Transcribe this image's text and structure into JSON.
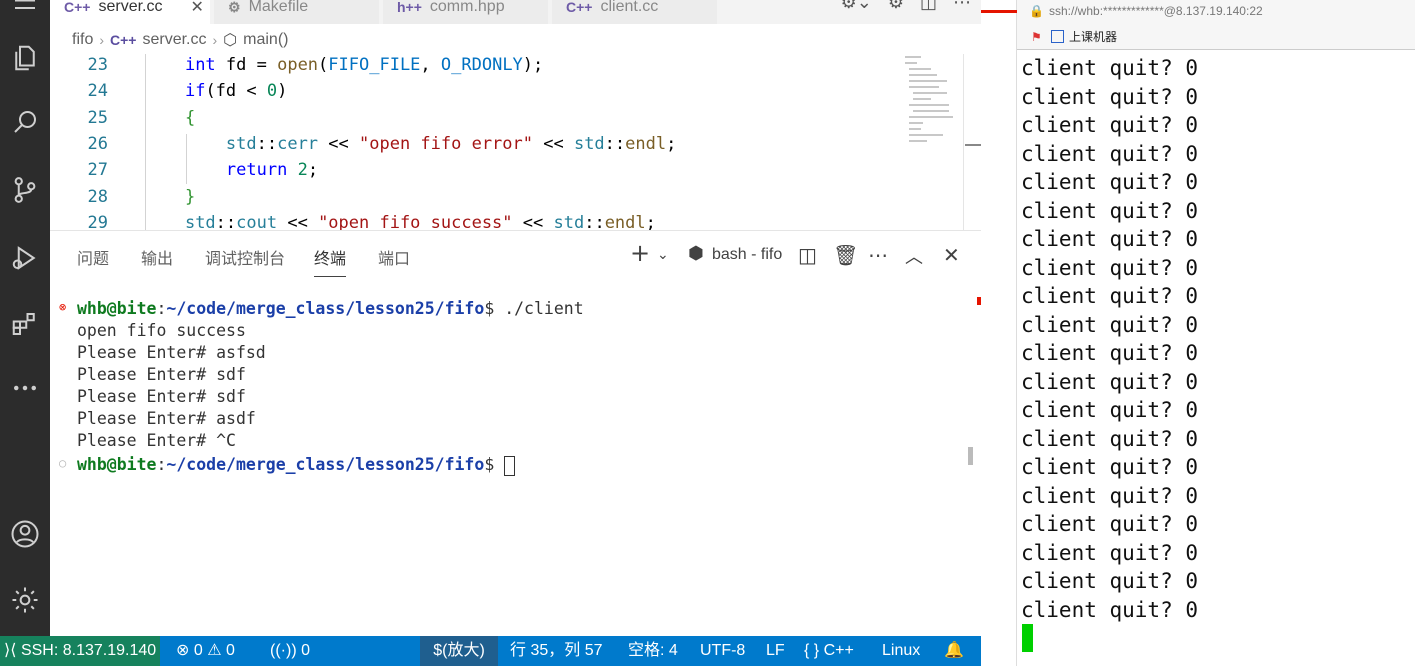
{
  "tabs": [
    {
      "label": "server.cc",
      "icon": "C++",
      "active": true
    },
    {
      "label": "Makefile",
      "icon": "gear"
    },
    {
      "label": "comm.hpp",
      "icon": "h++"
    },
    {
      "label": "client.cc",
      "icon": "C++"
    }
  ],
  "breadcrumb": {
    "folder": "fifo",
    "file": "server.cc",
    "symbol": "main()",
    "file_icon": "C++"
  },
  "code_lines": [
    {
      "n": "23",
      "indent": "    ",
      "parts": [
        [
          "kw",
          "int"
        ],
        [
          "",
          " fd = "
        ],
        [
          "fn",
          "open"
        ],
        [
          "",
          "("
        ],
        [
          "cst",
          "FIFO_FILE"
        ],
        [
          "",
          ", "
        ],
        [
          "cst",
          "O_RDONLY"
        ],
        [
          "",
          ");"
        ]
      ]
    },
    {
      "n": "24",
      "indent": "    ",
      "parts": [
        [
          "kw",
          "if"
        ],
        [
          "",
          "(fd < "
        ],
        [
          "num",
          "0"
        ],
        [
          "",
          ")"
        ]
      ]
    },
    {
      "n": "25",
      "indent": "    ",
      "parts": [
        [
          "br",
          "{"
        ]
      ]
    },
    {
      "n": "26",
      "indent": "        ",
      "parts": [
        [
          "ty",
          "std"
        ],
        [
          "",
          "::"
        ],
        [
          "ty",
          "cerr"
        ],
        [
          "",
          " << "
        ],
        [
          "str",
          "\"open fifo error\""
        ],
        [
          "",
          " << "
        ],
        [
          "ty",
          "std"
        ],
        [
          "",
          "::"
        ],
        [
          "fn",
          "endl"
        ],
        [
          "",
          ";"
        ]
      ]
    },
    {
      "n": "27",
      "indent": "        ",
      "parts": [
        [
          "kw",
          "return"
        ],
        [
          "",
          " "
        ],
        [
          "num",
          "2"
        ],
        [
          "",
          ";"
        ]
      ]
    },
    {
      "n": "28",
      "indent": "    ",
      "parts": [
        [
          "br",
          "}"
        ]
      ]
    },
    {
      "n": "29",
      "indent": "    ",
      "parts": [
        [
          "ty",
          "std"
        ],
        [
          "",
          "::"
        ],
        [
          "ty",
          "cout"
        ],
        [
          "",
          " << "
        ],
        [
          "str",
          "\"open fifo success\""
        ],
        [
          "",
          " << "
        ],
        [
          "ty",
          "std"
        ],
        [
          "",
          "::"
        ],
        [
          "fn",
          "endl"
        ],
        [
          "",
          ";"
        ]
      ]
    }
  ],
  "panel": {
    "tabs": [
      "问题",
      "输出",
      "调试控制台",
      "终端",
      "端口"
    ],
    "active_tab": "终端",
    "terminal_name": "bash - fifo"
  },
  "terminal": {
    "prompt_user": "whb@bite",
    "prompt_path": "~/code/merge_class/lesson25/fifo",
    "prompt_suffix": "$ ",
    "command": "./client",
    "output": [
      "open fifo success",
      "Please Enter# asfsd",
      "Please Enter# sdf",
      "Please Enter# sdf",
      "Please Enter# asdf",
      "Please Enter# ^C"
    ]
  },
  "statusbar": {
    "remote": "SSH: 8.137.19.140",
    "errors": "0",
    "warnings": "0",
    "ports": "0",
    "mode": "$(放大)",
    "position": "行 35，列 57",
    "spaces": "空格: 4",
    "encoding": "UTF-8",
    "eol": "LF",
    "language": "C++",
    "platform": "Linux"
  },
  "ssh": {
    "title": "ssh://whb:*************@8.137.19.140:22",
    "toolbar_label": "上课机器",
    "lines": [
      "client quit? 0",
      "client quit? 0",
      "client quit? 0",
      "client quit? 0",
      "client quit? 0",
      "client quit? 0",
      "client quit? 0",
      "client quit? 0",
      "client quit? 0",
      "client quit? 0",
      "client quit? 0",
      "client quit? 0",
      "client quit? 0",
      "client quit? 0",
      "client quit? 0",
      "client quit? 0",
      "client quit? 0",
      "client quit? 0",
      "client quit? 0",
      "client quit? 0"
    ]
  },
  "colors": {
    "statusbar": "#007acc",
    "remote": "#16825d",
    "activity_bar": "#2c2c2c",
    "ssh_cursor": "#00d000"
  }
}
